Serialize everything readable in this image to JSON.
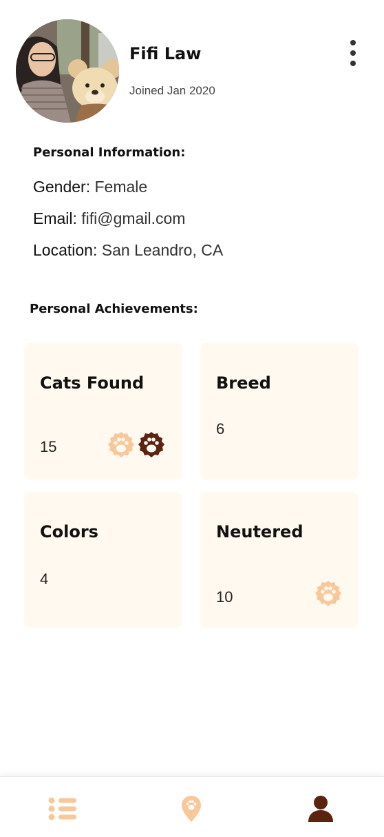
{
  "profile": {
    "name": "Fifi Law",
    "joined": "Joined Jan 2020"
  },
  "personal_info": {
    "title": "Personal Information:",
    "rows": [
      {
        "label": "Gender:",
        "value": "Female"
      },
      {
        "label": "Email:",
        "value": "fifi@gmail.com"
      },
      {
        "label": "Location:",
        "value": "San Leandro, CA"
      }
    ]
  },
  "achievements": {
    "title": "Personal Achievements:",
    "cards": [
      {
        "title": "Cats Found",
        "value": "15",
        "badges": [
          "paw-badge-light-icon",
          "paw-badge-dark-icon"
        ]
      },
      {
        "title": "Breed",
        "value": "6",
        "badges": []
      },
      {
        "title": "Colors",
        "value": "4",
        "badges": []
      },
      {
        "title": "Neutered",
        "value": "10",
        "badges": [
          "paw-badge-light-icon"
        ]
      }
    ]
  },
  "nav": {
    "items": [
      {
        "icon": "list-icon",
        "active": false
      },
      {
        "icon": "map-pin-paw-icon",
        "active": false
      },
      {
        "icon": "user-icon",
        "active": true
      }
    ]
  },
  "colors": {
    "accent_light": "#f8c89a",
    "accent_dark": "#5a2410",
    "card_bg": "#fff9f0"
  }
}
